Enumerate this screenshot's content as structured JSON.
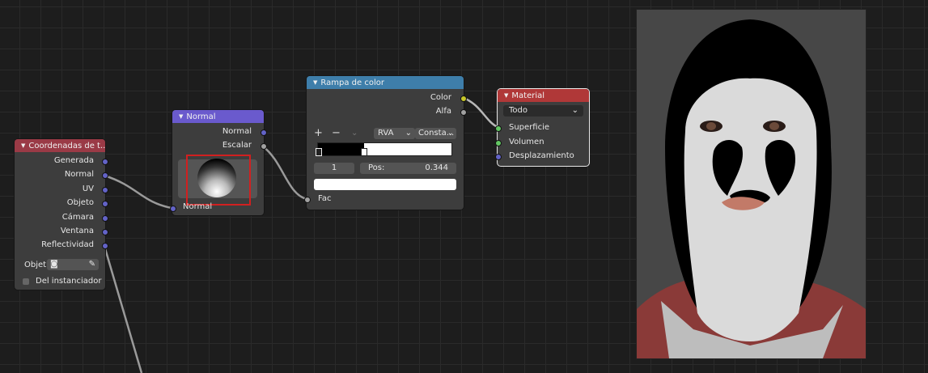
{
  "colors": {
    "texcoord_header": "#9a3a46",
    "normal_header": "#6a5acd",
    "ramp_header": "#3e7eaa",
    "material_header": "#b03838",
    "highlight_box": "#d12020",
    "link": "#9a9a9a"
  },
  "texcoord_node": {
    "title": "Coordenadas de t..",
    "outputs": [
      "Generada",
      "Normal",
      "UV",
      "Objeto",
      "Cámara",
      "Ventana",
      "Reflectividad"
    ],
    "object_label": "Objet",
    "object_icon": "object-picker-icon",
    "instancer_label": "Del instanciador"
  },
  "normal_node": {
    "title": "Normal",
    "output_normal": "Normal",
    "output_dot": "Escalar",
    "input_normal": "Normal"
  },
  "ramp_node": {
    "title": "Rampa de color",
    "output_color": "Color",
    "output_alpha": "Alfa",
    "add": "+",
    "remove": "−",
    "mode": "RVA",
    "interpolation": "Consta...",
    "stop_index": "1",
    "pos_label": "Pos:",
    "pos_value": "0.344",
    "input_fac": "Fac"
  },
  "material_node": {
    "title": "Material",
    "target": "Todo",
    "inputs": [
      "Superficie",
      "Volumen",
      "Desplazamiento"
    ]
  }
}
